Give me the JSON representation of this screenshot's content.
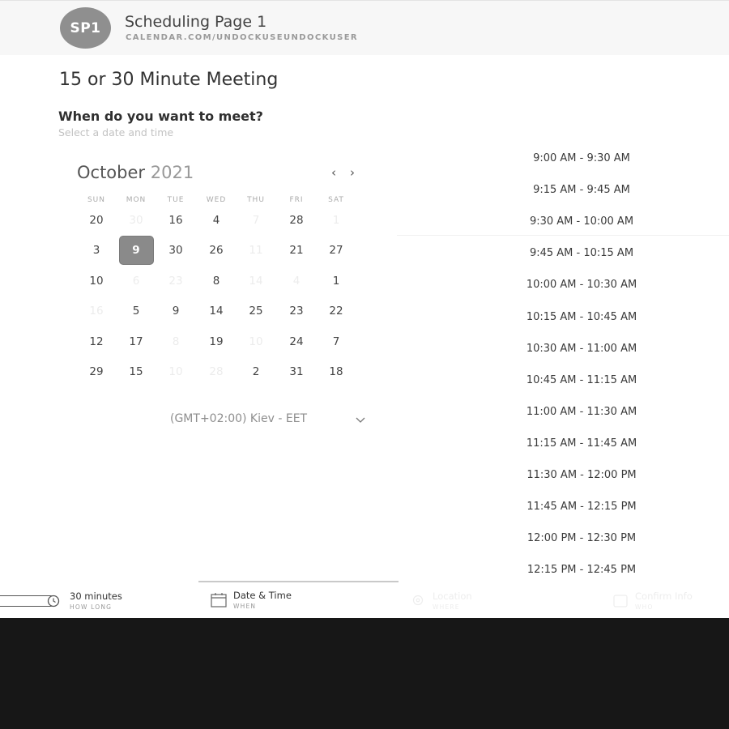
{
  "header": {
    "avatar": "SP1",
    "title": "Scheduling Page 1",
    "url": "CALENDAR.COM/UNDOCKUSEUNDOCKUSER"
  },
  "meeting_title": "15 or 30 Minute Meeting",
  "question": "When do you want to meet?",
  "hint": "Select a date and time",
  "calendar": {
    "month": "October",
    "year": "2021",
    "weekdays": [
      "SUN",
      "MON",
      "TUE",
      "WED",
      "THU",
      "FRI",
      "SAT"
    ],
    "weeks": [
      [
        {
          "d": "20"
        },
        {
          "d": "30",
          "disabled": true
        },
        {
          "d": "16"
        },
        {
          "d": "4"
        },
        {
          "d": "7",
          "disabled": true
        },
        {
          "d": "28"
        },
        {
          "d": "1",
          "disabled": true
        }
      ],
      [
        {
          "d": "3"
        },
        {
          "d": "9",
          "selected": true
        },
        {
          "d": "30"
        },
        {
          "d": "26"
        },
        {
          "d": "11",
          "disabled": true
        },
        {
          "d": "21"
        },
        {
          "d": "27"
        }
      ],
      [
        {
          "d": "10"
        },
        {
          "d": "6",
          "disabled": true
        },
        {
          "d": "23",
          "disabled": true
        },
        {
          "d": "8"
        },
        {
          "d": "14",
          "disabled": true
        },
        {
          "d": "4",
          "disabled": true
        },
        {
          "d": "1"
        }
      ],
      [
        {
          "d": "16",
          "disabled": true
        },
        {
          "d": "5"
        },
        {
          "d": "9"
        },
        {
          "d": "14"
        },
        {
          "d": "25"
        },
        {
          "d": "23"
        },
        {
          "d": "22"
        }
      ],
      [
        {
          "d": "12"
        },
        {
          "d": "17"
        },
        {
          "d": "8",
          "disabled": true
        },
        {
          "d": "19"
        },
        {
          "d": "10",
          "disabled": true
        },
        {
          "d": "24"
        },
        {
          "d": "7"
        }
      ],
      [
        {
          "d": "29"
        },
        {
          "d": "15"
        },
        {
          "d": "10",
          "disabled": true
        },
        {
          "d": "28",
          "disabled": true
        },
        {
          "d": "2"
        },
        {
          "d": "31"
        },
        {
          "d": "18"
        }
      ]
    ]
  },
  "timezone": "(GMT+02:00) Kiev - EET",
  "time_slots": [
    "9:00 AM - 9:30 AM",
    "9:15 AM - 9:45 AM",
    "9:30 AM - 10:00 AM",
    "9:45 AM - 10:15 AM",
    "10:00 AM - 10:30 AM",
    "10:15 AM - 10:45 AM",
    "10:30 AM - 11:00 AM",
    "10:45 AM - 11:15 AM",
    "11:00 AM - 11:30 AM",
    "11:15 AM - 11:45 AM",
    "11:30 AM - 12:00 PM",
    "11:45 AM - 12:15 PM",
    "12:00 PM - 12:30 PM",
    "12:15 PM - 12:45 PM"
  ],
  "steps": {
    "duration": {
      "label": "30 minutes",
      "sub": "HOW LONG"
    },
    "datetime": {
      "label": "Date & Time",
      "sub": "WHEN"
    },
    "location": {
      "label": "Location",
      "sub": "WHERE"
    },
    "confirm": {
      "label": "Confirm Info",
      "sub": "WHO"
    }
  },
  "icons": {
    "prev": "chevron-left-icon",
    "next": "chevron-right-icon",
    "timezone": "chevron-down-icon",
    "duration": "slider-icon",
    "datetime": "calendar-icon",
    "location": "location-pin-icon",
    "confirm": "user-icon"
  }
}
